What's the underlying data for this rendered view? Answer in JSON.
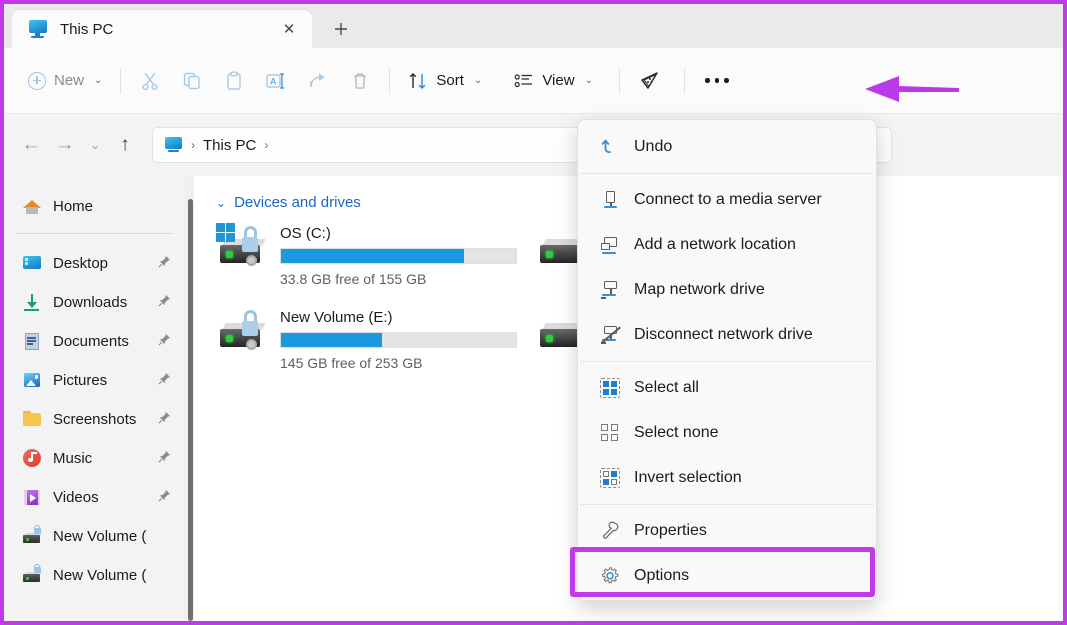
{
  "window": {
    "border_color": "#c13ae8",
    "title": "This PC"
  },
  "tabbar": {
    "tab_label": "This PC",
    "tab_icon": "this-pc-monitor-icon",
    "close_label": "✕",
    "new_tab_label": "＋"
  },
  "toolbar": {
    "new_label": "New",
    "new_chevron": "⌄",
    "cut_icon": "scissors-icon",
    "copy_icon": "copy-icon",
    "paste_icon": "paste-icon",
    "rename_icon": "rename-icon",
    "share_icon": "share-icon",
    "delete_icon": "trash-icon",
    "sort_label": "Sort",
    "sort_chevron": "⌄",
    "view_label": "View",
    "view_chevron": "⌄",
    "filter_icon": "filter-slice-icon",
    "more_icon": "ellipsis-icon"
  },
  "navbar": {
    "back_glyph": "←",
    "forward_glyph": "→",
    "recent_glyph": "⌄",
    "up_glyph": "↑",
    "address": {
      "icon": "this-pc-monitor-icon",
      "crumb": "This PC",
      "sep1": "›",
      "sep2": "›"
    }
  },
  "sidebar": {
    "items": [
      {
        "label": "Home",
        "icon": "home-icon",
        "pinned": false
      },
      {
        "label": "Desktop",
        "icon": "desktop-icon",
        "pinned": true
      },
      {
        "label": "Downloads",
        "icon": "downloads-icon",
        "pinned": true
      },
      {
        "label": "Documents",
        "icon": "documents-icon",
        "pinned": true
      },
      {
        "label": "Pictures",
        "icon": "pictures-icon",
        "pinned": true
      },
      {
        "label": "Screenshots",
        "icon": "folder-icon",
        "pinned": true
      },
      {
        "label": "Music",
        "icon": "music-icon",
        "pinned": true
      },
      {
        "label": "Videos",
        "icon": "videos-icon",
        "pinned": true
      },
      {
        "label": "New Volume (",
        "icon": "drive-icon",
        "pinned": false
      },
      {
        "label": "New Volume (",
        "icon": "drive-icon",
        "pinned": false
      }
    ],
    "pin_glyph": "📌"
  },
  "content": {
    "group_title": "Devices and drives",
    "group_chevron": "⌄",
    "drives": [
      {
        "name": "OS (C:)",
        "free_text": "33.8 GB free of 155 GB",
        "used_percent": 78,
        "icon": "windows-drive-locked-icon",
        "bar_color": "#1b9ae0"
      },
      {
        "name": "New Volume (E:)",
        "free_text": "145 GB free of 253 GB",
        "used_percent": 43,
        "icon": "drive-locked-icon",
        "bar_color": "#1b9ae0"
      }
    ]
  },
  "menu": {
    "items": [
      {
        "label": "Undo",
        "icon": "undo-icon",
        "kind": "undo"
      },
      {
        "label": "",
        "kind": "separator"
      },
      {
        "label": "Connect to a media server",
        "icon": "media-server-icon",
        "kind": "media"
      },
      {
        "label": "Add a network location",
        "icon": "add-network-location-icon",
        "kind": "net"
      },
      {
        "label": "Map network drive",
        "icon": "map-network-drive-icon",
        "kind": "map"
      },
      {
        "label": "Disconnect network drive",
        "icon": "disconnect-network-drive-icon",
        "kind": "dis"
      },
      {
        "label": "",
        "kind": "separator"
      },
      {
        "label": "Select all",
        "icon": "select-all-icon",
        "kind": "selall"
      },
      {
        "label": "Select none",
        "icon": "select-none-icon",
        "kind": "selnone"
      },
      {
        "label": "Invert selection",
        "icon": "invert-selection-icon",
        "kind": "inv"
      },
      {
        "label": "",
        "kind": "separator"
      },
      {
        "label": "Properties",
        "icon": "wrench-icon",
        "kind": "prop"
      },
      {
        "label": "Options",
        "icon": "gear-icon",
        "kind": "gear"
      }
    ]
  },
  "annotations": {
    "highlight_color": "#c13ae8",
    "highlight_target": "Options",
    "arrow_color": "#bb3ae8",
    "arrow_target": "ellipsis-icon"
  }
}
